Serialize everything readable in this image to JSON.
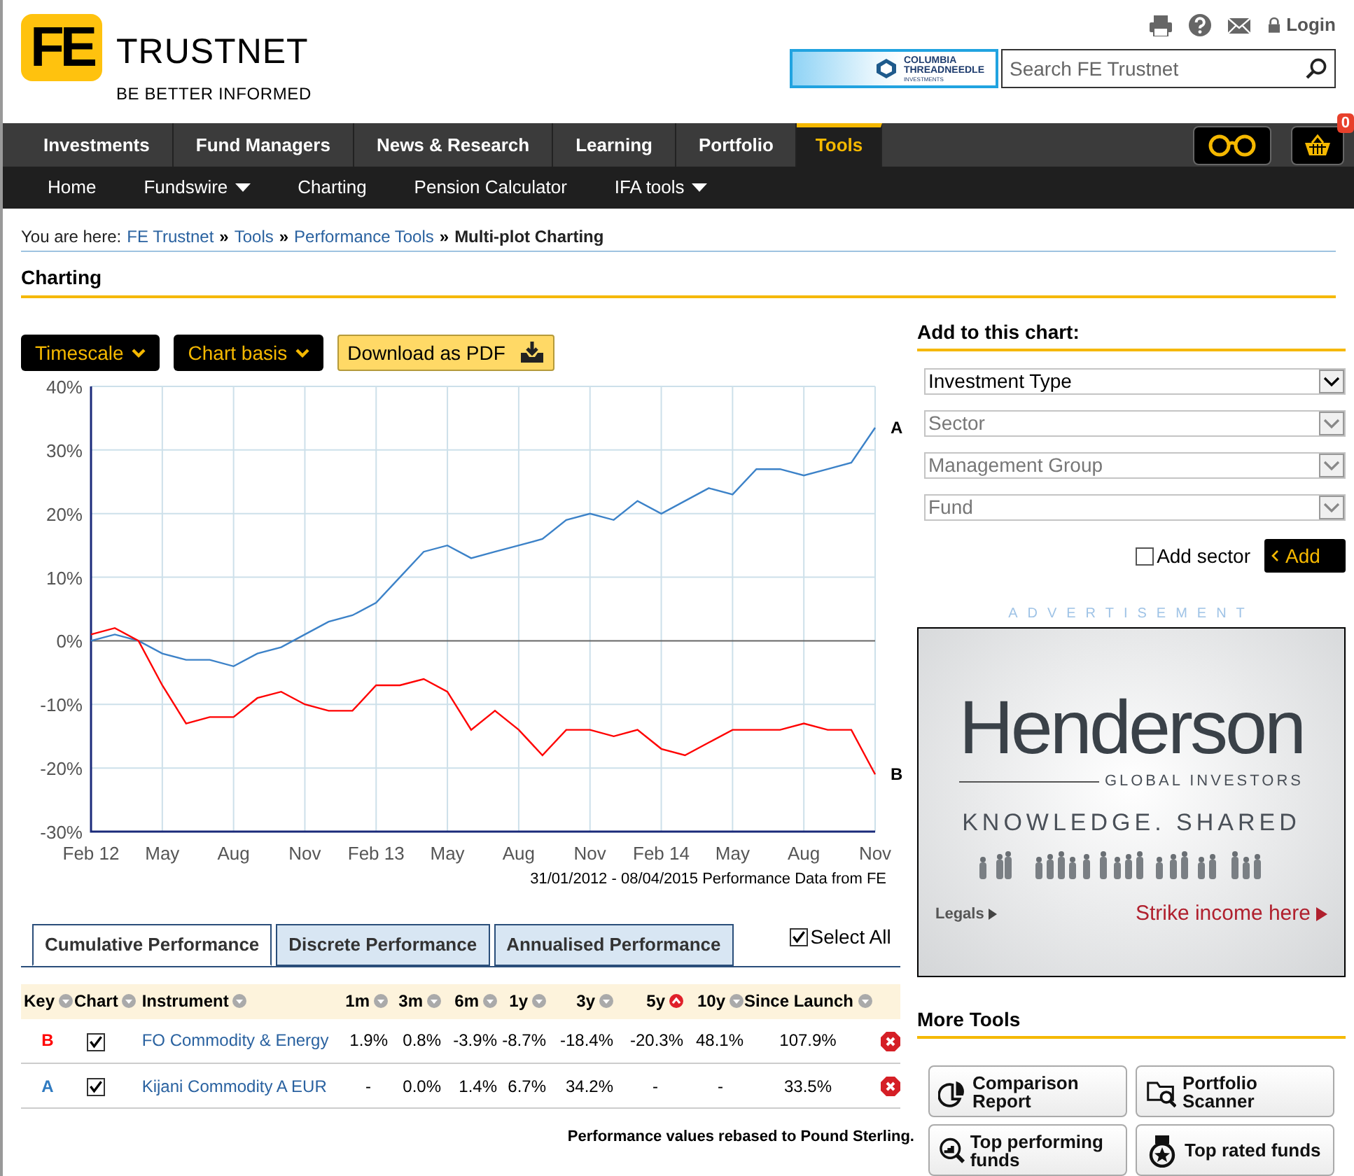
{
  "logo": {
    "mark": "FE",
    "name": "TRUSTNET",
    "tagline": "BE BETTER INFORMED"
  },
  "utility_links": [
    {
      "kind": "print"
    },
    {
      "kind": "help"
    },
    {
      "kind": "mail"
    },
    {
      "kind": "login",
      "label": "Login"
    }
  ],
  "sponsor_banner": {
    "line1": "COLUMBIA",
    "line2": "THREADNEEDLE",
    "line3": "INVESTMENTS"
  },
  "search": {
    "placeholder": "Search FE Trustnet"
  },
  "main_nav": [
    {
      "label": "Investments",
      "selected": false
    },
    {
      "label": "Fund Managers",
      "selected": false
    },
    {
      "label": "News & Research",
      "selected": false
    },
    {
      "label": "Learning",
      "selected": false
    },
    {
      "label": "Portfolio",
      "selected": false
    },
    {
      "label": "Tools",
      "selected": true
    }
  ],
  "basket": {
    "count": "0"
  },
  "sub_nav": [
    {
      "label": "Home",
      "dropdown": false
    },
    {
      "label": "Fundswire",
      "dropdown": true
    },
    {
      "label": "Charting",
      "dropdown": false
    },
    {
      "label": "Pension Calculator",
      "dropdown": false
    },
    {
      "label": "IFA tools",
      "dropdown": true
    }
  ],
  "breadcrumb": {
    "prefix": "You are here:",
    "links": [
      "FE Trustnet",
      "Tools",
      "Performance Tools"
    ],
    "current": "Multi-plot Charting",
    "separator": "»"
  },
  "page_title": "Charting",
  "chart_buttons": [
    {
      "label": "Timescale",
      "kind": "menu"
    },
    {
      "label": "Chart basis",
      "kind": "menu"
    },
    {
      "label": "Download as PDF",
      "kind": "download"
    }
  ],
  "chart_data": {
    "type": "line",
    "categories": [
      "Feb 12",
      null,
      null,
      "May",
      null,
      null,
      "Aug",
      null,
      null,
      "Nov",
      null,
      null,
      "Feb 13",
      null,
      null,
      "May",
      null,
      null,
      "Aug",
      null,
      null,
      "Nov",
      null,
      null,
      "Feb 14",
      null,
      null,
      "May",
      null,
      null,
      "Aug",
      null,
      null,
      "Nov"
    ],
    "ylim": [
      -30,
      40
    ],
    "grid": true,
    "yticks": [
      {
        "value": 40,
        "label": "40%"
      },
      {
        "value": 30,
        "label": "30%"
      },
      {
        "value": 20,
        "label": "20%"
      },
      {
        "value": 10,
        "label": "10%"
      },
      {
        "value": 0,
        "label": "0%"
      },
      {
        "value": -10,
        "label": "-10%"
      },
      {
        "value": -20,
        "label": "-20%"
      },
      {
        "value": -30,
        "label": "-30%"
      }
    ],
    "series": [
      {
        "name": "A",
        "color": "#3c82c8",
        "values": [
          0,
          1,
          0,
          -2,
          -3,
          -3,
          -4,
          -2,
          -1,
          1,
          3,
          4,
          6,
          10,
          14,
          15,
          13,
          14,
          15,
          16,
          19,
          20,
          19,
          22,
          20,
          22,
          24,
          23,
          27,
          27,
          26,
          27,
          28,
          33.5
        ]
      },
      {
        "name": "B",
        "color": "#ff0000",
        "values": [
          1,
          2,
          0,
          -7,
          -13,
          -12,
          -12,
          -9,
          -8,
          -10,
          -11,
          -11,
          -7,
          -7,
          -6,
          -8,
          -14,
          -11,
          -14,
          -18,
          -14,
          -14,
          -15,
          -14,
          -17,
          -18,
          -16,
          -14,
          -14,
          -14,
          -13,
          -14,
          -14,
          -21
        ]
      }
    ]
  },
  "chart_caption": "31/01/2012 - 08/04/2015 Performance Data from FE",
  "perf_tabs": [
    {
      "label": "Cumulative Performance",
      "selected": true
    },
    {
      "label": "Discrete Performance",
      "selected": false
    },
    {
      "label": "Annualised Performance",
      "selected": false
    }
  ],
  "select_all": {
    "label": "Select All",
    "checked": true
  },
  "table": {
    "columns": [
      {
        "label": "Key",
        "sorted": false
      },
      {
        "label": "Chart",
        "sorted": false
      },
      {
        "label": "Instrument",
        "sorted": false
      },
      {
        "label": "1m",
        "sorted": false
      },
      {
        "label": "3m",
        "sorted": false
      },
      {
        "label": "6m",
        "sorted": false
      },
      {
        "label": "1y",
        "sorted": false
      },
      {
        "label": "3y",
        "sorted": false
      },
      {
        "label": "5y",
        "sorted": true
      },
      {
        "label": "10y",
        "sorted": false
      },
      {
        "label": "Since Launch",
        "sorted": false
      }
    ],
    "rows": [
      {
        "key": "B",
        "color": "#ff0000",
        "checked": true,
        "instrument": "FO Commodity & Energy",
        "values": [
          "1.9%",
          "0.8%",
          "-3.9%",
          "-8.7%",
          "-18.4%",
          "-20.3%",
          "48.1%",
          "107.9%"
        ]
      },
      {
        "key": "A",
        "color": "#2f7ac0",
        "checked": true,
        "instrument": "Kijani Commodity A EUR",
        "values": [
          "-",
          "0.0%",
          "1.4%",
          "6.7%",
          "34.2%",
          "-",
          "-",
          "33.5%"
        ]
      }
    ]
  },
  "table_note": "Performance values rebased to Pound Sterling.",
  "add_panel": {
    "title": "Add to this chart:",
    "selects": [
      {
        "value": "Investment Type",
        "disabled": false
      },
      {
        "value": "Sector",
        "disabled": true
      },
      {
        "value": "Management Group",
        "disabled": true
      },
      {
        "value": "Fund",
        "disabled": true
      }
    ],
    "add_sector": {
      "label": "Add sector",
      "checked": false
    },
    "button": "Add"
  },
  "advert": {
    "label": "ADVERTISEMENT",
    "brand": "Henderson",
    "subbrand": "GLOBAL INVESTORS",
    "slogan": "KNOWLEDGE. SHARED",
    "legals": "Legals",
    "cta": "Strike income here"
  },
  "more_tools": {
    "title": "More Tools",
    "items": [
      {
        "label": "Comparison Report",
        "kind": "pie"
      },
      {
        "label": "Portfolio Scanner",
        "kind": "folder"
      },
      {
        "label": "Top performing funds",
        "kind": "magnifier"
      },
      {
        "label": "Top rated funds",
        "kind": "medal"
      }
    ]
  }
}
